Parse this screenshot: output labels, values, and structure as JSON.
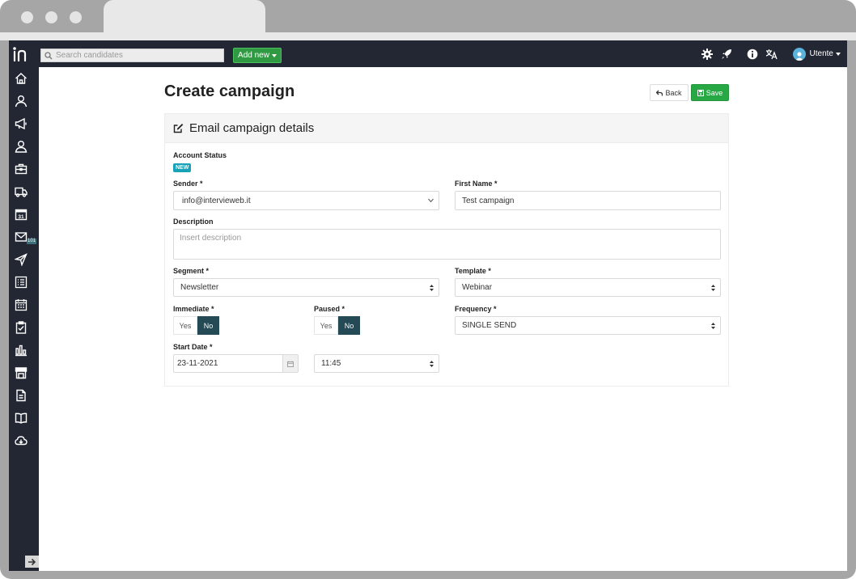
{
  "search": {
    "placeholder": "Search candidates"
  },
  "header": {
    "add_new_label": "Add new",
    "user_name": "Utente"
  },
  "sidebar": {
    "mail_badge": "101"
  },
  "page": {
    "title": "Create campaign",
    "back_label": "Back",
    "save_label": "Save"
  },
  "panel": {
    "title": "Email campaign details",
    "account_status_label": "Account Status",
    "account_status_badge": "NEW",
    "sender_label": "Sender *",
    "sender_value": "info@intervieweb.it",
    "first_name_label": "First Name *",
    "first_name_value": "Test campaign",
    "description_label": "Description",
    "description_placeholder": "Insert description",
    "segment_label": "Segment *",
    "segment_value": "Newsletter",
    "template_label": "Template *",
    "template_value": "Webinar",
    "immediate_label": "Immediate *",
    "paused_label": "Paused *",
    "yes_label": "Yes",
    "no_label": "No",
    "frequency_label": "Frequency *",
    "frequency_value": "SINGLE SEND",
    "start_date_label": "Start Date *",
    "start_date_value": "23-11-2021",
    "start_time_value": "11:45"
  },
  "colors": {
    "navbar": "#222733",
    "add_new": "#2f9a41",
    "save": "#28a745",
    "toggle_active": "#234a55",
    "badge_new": "#17a2b8"
  }
}
